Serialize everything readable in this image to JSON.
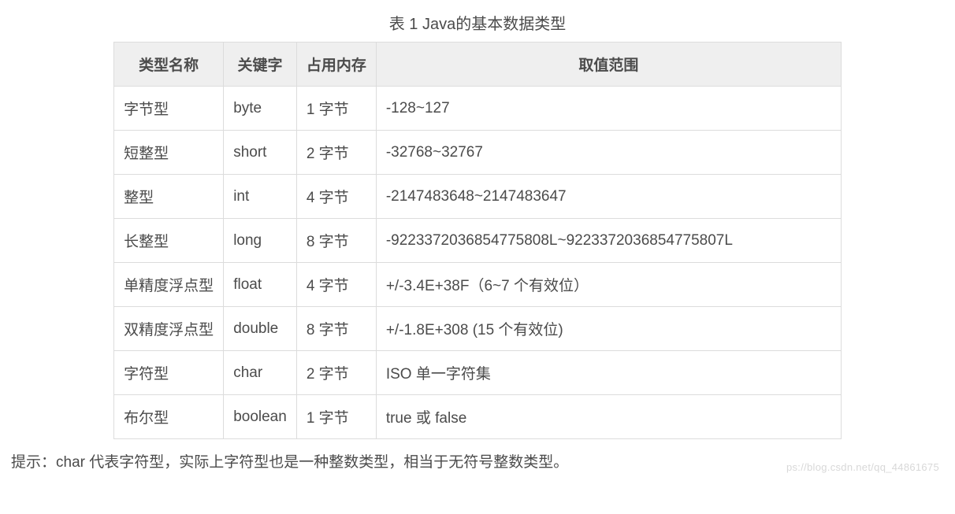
{
  "caption": "表 1 Java的基本数据类型",
  "headers": {
    "name": "类型名称",
    "keyword": "关键字",
    "memory": "占用内存",
    "range": "取值范围"
  },
  "rows": [
    {
      "name": "字节型",
      "keyword": "byte",
      "memory": "1 字节",
      "range": "-128~127"
    },
    {
      "name": "短整型",
      "keyword": "short",
      "memory": "2 字节",
      "range": "-32768~32767"
    },
    {
      "name": "整型",
      "keyword": "int",
      "memory": "4 字节",
      "range": "-2147483648~2147483647"
    },
    {
      "name": "长整型",
      "keyword": "long",
      "memory": "8 字节",
      "range": "-9223372036854775808L~9223372036854775807L"
    },
    {
      "name": "单精度浮点型",
      "keyword": "float",
      "memory": "4 字节",
      "range": "+/-3.4E+38F（6~7 个有效位）"
    },
    {
      "name": "双精度浮点型",
      "keyword": "double",
      "memory": "8 字节",
      "range": "+/-1.8E+308 (15 个有效位)"
    },
    {
      "name": "字符型",
      "keyword": "char",
      "memory": "2 字节",
      "range": "ISO 单一字符集"
    },
    {
      "name": "布尔型",
      "keyword": "boolean",
      "memory": "1 字节",
      "range": "true 或 false"
    }
  ],
  "note": "提示：char 代表字符型，实际上字符型也是一种整数类型，相当于无符号整数类型。",
  "watermark": "ps://blog.csdn.net/qq_44861675"
}
